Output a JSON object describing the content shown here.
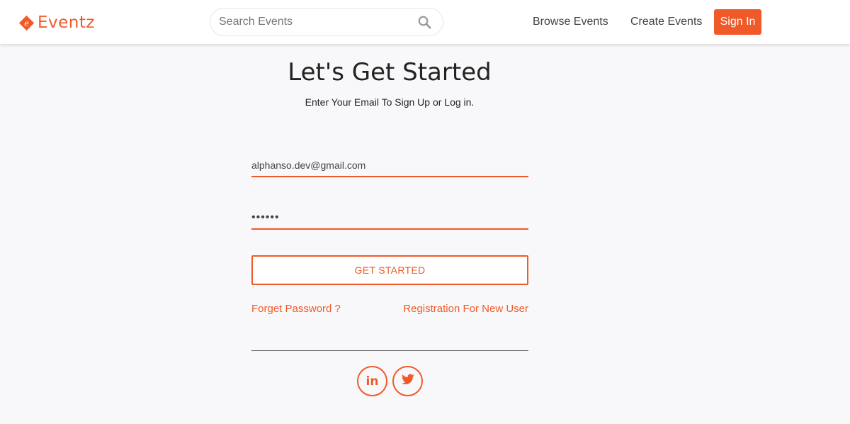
{
  "header": {
    "brand": "Eventz",
    "search_placeholder": "Search Events",
    "nav": {
      "browse": "Browse Events",
      "create": "Create Events",
      "signin": "Sign In"
    }
  },
  "main": {
    "title": "Let's Get Started",
    "subtitle": "Enter Your Email To Sign Up or Log in.",
    "email_value": "alphanso.dev@gmail.com",
    "password_value": "••••••",
    "submit_label": "GET STARTED",
    "forgot_label": "Forget Password ?",
    "register_label": "Registration For New User",
    "social_linkedin": "in"
  },
  "colors": {
    "accent": "#f05a28",
    "background": "#f8f8fa"
  },
  "icons": [
    "logo-diamond-icon",
    "search-icon",
    "linkedin-icon",
    "twitter-icon"
  ]
}
